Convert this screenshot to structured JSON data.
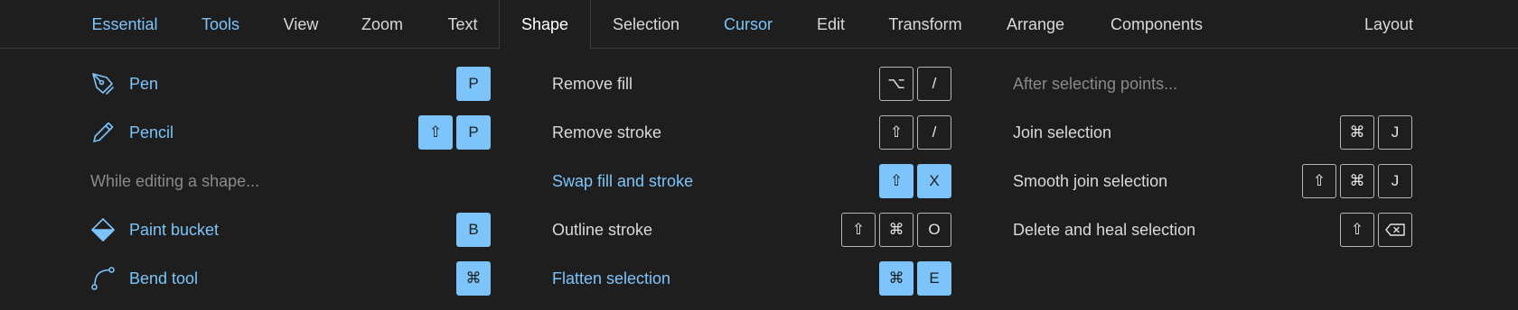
{
  "tabs": [
    {
      "id": "essential",
      "label": "Essential"
    },
    {
      "id": "tools",
      "label": "Tools"
    },
    {
      "id": "view",
      "label": "View"
    },
    {
      "id": "zoom",
      "label": "Zoom"
    },
    {
      "id": "text",
      "label": "Text"
    },
    {
      "id": "shape",
      "label": "Shape"
    },
    {
      "id": "selection",
      "label": "Selection"
    },
    {
      "id": "cursor",
      "label": "Cursor"
    },
    {
      "id": "edit",
      "label": "Edit"
    },
    {
      "id": "transform",
      "label": "Transform"
    },
    {
      "id": "arrange",
      "label": "Arrange"
    },
    {
      "id": "components",
      "label": "Components"
    },
    {
      "id": "layout",
      "label": "Layout"
    }
  ],
  "active_tab": "Shape",
  "colors": {
    "accent": "#7cc4fa",
    "background": "#1e1e1e",
    "text": "#d9d9d9",
    "hint": "#8a8a8a"
  },
  "col1": {
    "pen": {
      "label": "Pen",
      "icon": "pen-icon",
      "keys": [
        "P"
      ]
    },
    "pencil": {
      "label": "Pencil",
      "icon": "pencil-icon",
      "keys": [
        "⇧",
        "P"
      ]
    },
    "hint": "While editing a shape...",
    "paint_bucket": {
      "label": "Paint bucket",
      "icon": "paint-bucket-icon",
      "keys": [
        "B"
      ]
    },
    "bend_tool": {
      "label": "Bend tool",
      "icon": "bend-tool-icon",
      "keys": [
        "⌘"
      ]
    }
  },
  "col2": {
    "remove_fill": {
      "label": "Remove fill",
      "keys": [
        "⌥",
        "/"
      ]
    },
    "remove_stroke": {
      "label": "Remove stroke",
      "keys": [
        "⇧",
        "/"
      ]
    },
    "swap": {
      "label": "Swap fill and stroke",
      "keys": [
        "⇧",
        "X"
      ]
    },
    "outline_stroke": {
      "label": "Outline stroke",
      "keys": [
        "⇧",
        "⌘",
        "O"
      ]
    },
    "flatten": {
      "label": "Flatten selection",
      "keys": [
        "⌘",
        "E"
      ]
    }
  },
  "col3": {
    "hint": "After selecting points...",
    "join": {
      "label": "Join selection",
      "keys": [
        "⌘",
        "J"
      ]
    },
    "smooth_join": {
      "label": "Smooth join selection",
      "keys": [
        "⇧",
        "⌘",
        "J"
      ]
    },
    "delete_heal": {
      "label": "Delete and heal selection",
      "keys": [
        "⇧",
        "⌫"
      ],
      "icons": [
        "shift-icon",
        "backspace-icon"
      ]
    }
  }
}
